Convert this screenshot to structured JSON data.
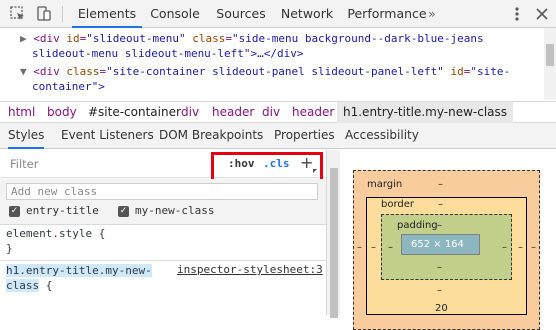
{
  "toolbar": {
    "tabs": [
      "Elements",
      "Console",
      "Sources",
      "Network",
      "Performance"
    ],
    "active_tab": "Elements",
    "more_icon": "kebab-icon"
  },
  "dom": {
    "line1_tag_open": "<div",
    "line1_attr1": "id",
    "line1_val1": "\"slideout-menu\"",
    "line1_attr2": "class",
    "line1_val2": "\"side-menu background--dark-blue-jeans",
    "line2": "slideout-menu slideout-menu-left\">…</div>",
    "line3_tag_open": "<div",
    "line3_attr1": "class",
    "line3_val1": "\"site-container slideout-panel slideout-panel-left\"",
    "line3_attr2": "id",
    "line3_val2": "\"site-",
    "line4": "container\">"
  },
  "breadcrumbs": [
    "html",
    "body",
    "#site-container",
    "div",
    "header",
    "div",
    "header",
    "h1.entry-title.my-new-class"
  ],
  "subtabs": [
    "Styles",
    "Event Listeners",
    "DOM Breakpoints",
    "Properties",
    "Accessibility"
  ],
  "styles": {
    "filter_placeholder": "Filter",
    "hov": ":hov",
    "cls": ".cls",
    "plus": "+",
    "add_class_placeholder": "Add new class",
    "classes": [
      {
        "name": "entry-title",
        "checked": true
      },
      {
        "name": "my-new-class",
        "checked": true
      }
    ],
    "element_style_open": "element.style {",
    "element_style_close": "}",
    "rule_selector_line1": "h1.entry-title.my-new-",
    "rule_selector_line2": "class",
    "rule_brace": " {",
    "rule_source": "inspector-stylesheet:3"
  },
  "box_model": {
    "margin_label": "margin",
    "border_label": "border",
    "padding_label": "padding",
    "dash": "–",
    "content_size": "652 × 164",
    "margin_bottom": "20"
  }
}
